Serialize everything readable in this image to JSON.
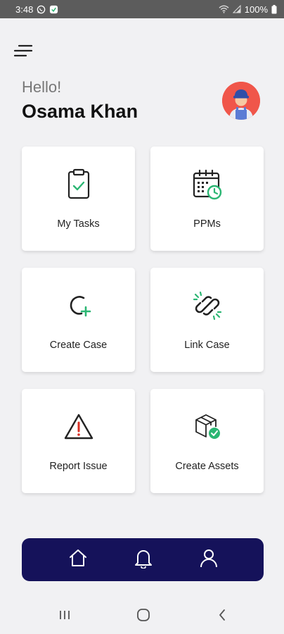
{
  "status_bar": {
    "time": "3:48",
    "battery": "100%",
    "icons": [
      "whatsapp-icon",
      "app-notification-icon",
      "wifi-icon",
      "signal-icon",
      "battery-icon"
    ]
  },
  "header": {
    "menu_icon": "hamburger-menu-icon",
    "greeting": "Hello!",
    "user_name": "Osama Khan",
    "avatar_icon": "worker-avatar"
  },
  "tiles": [
    {
      "label": "My Tasks",
      "icon": "clipboard-check-icon"
    },
    {
      "label": "PPMs",
      "icon": "calendar-clock-icon"
    },
    {
      "label": "Create Case",
      "icon": "create-case-icon"
    },
    {
      "label": "Link Case",
      "icon": "link-icon"
    },
    {
      "label": "Report Issue",
      "icon": "warning-icon"
    },
    {
      "label": "Create Assets",
      "icon": "box-check-icon"
    }
  ],
  "bottom_nav": {
    "items": [
      "home-icon",
      "bell-icon",
      "user-icon"
    ]
  },
  "system_nav": {
    "items": [
      "recents-icon",
      "home-circle-icon",
      "back-icon"
    ]
  },
  "colors": {
    "accent": "#2bb673",
    "nav_bg": "#15125a",
    "avatar_bg": "#f0564a",
    "warning_red": "#d93025",
    "page_bg": "#f1f1f3"
  }
}
